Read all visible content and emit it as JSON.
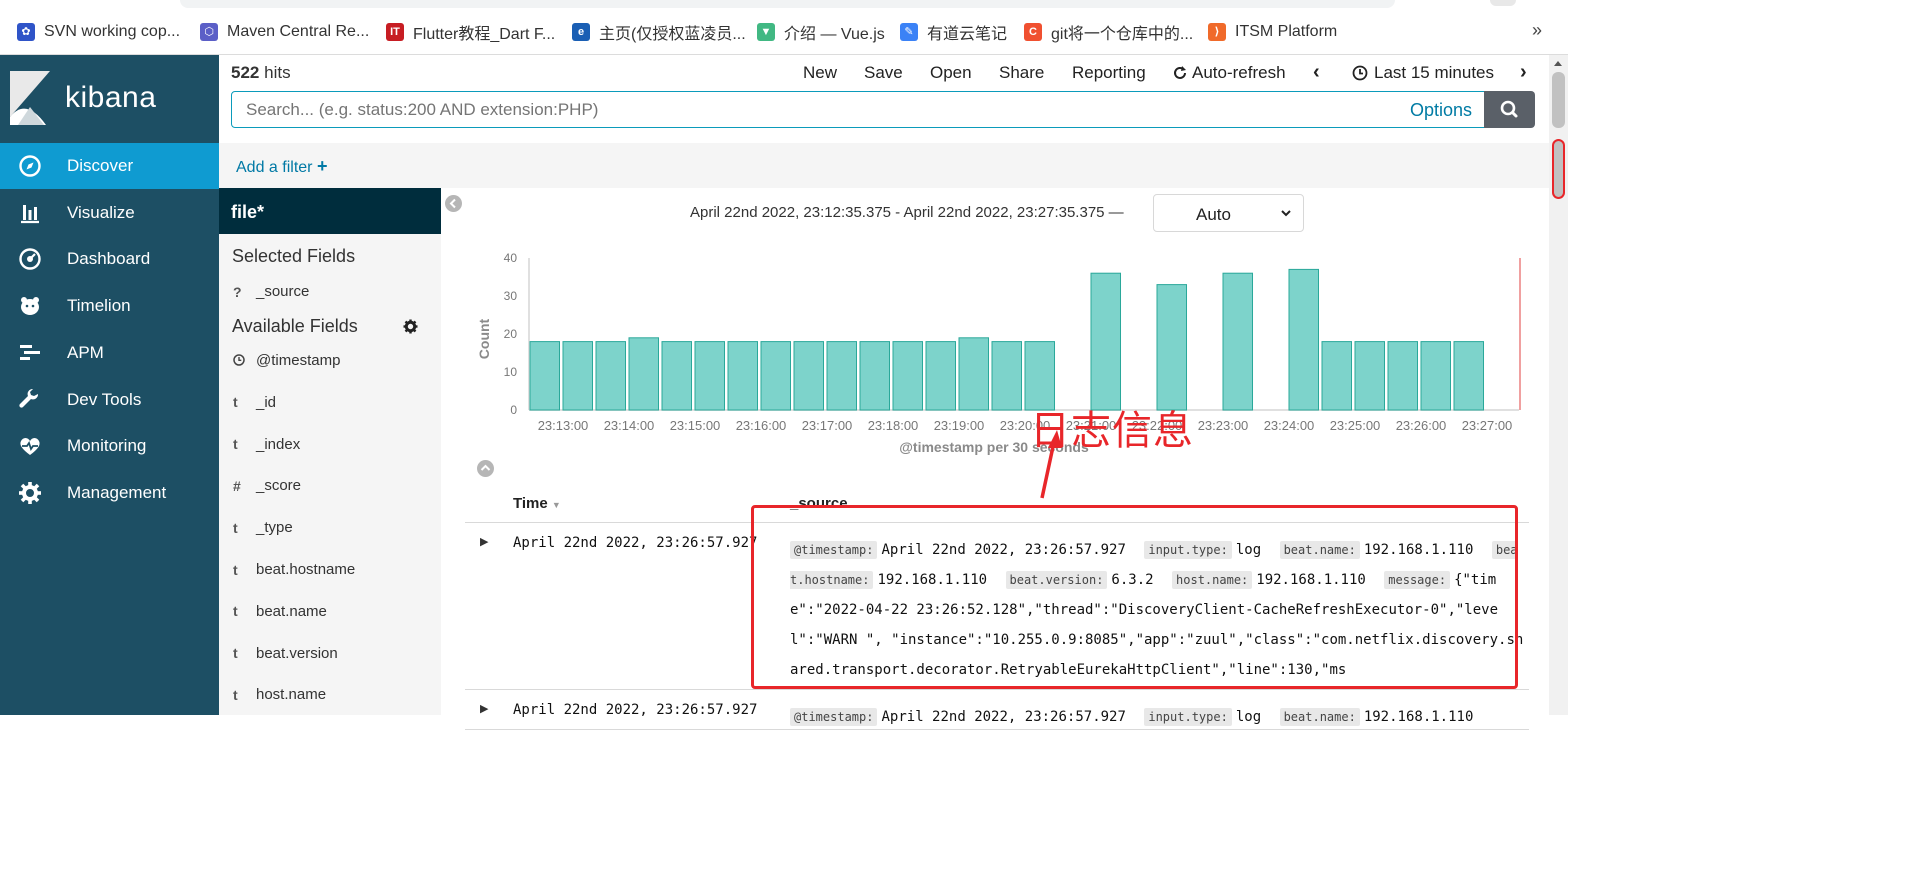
{
  "bookmarks": [
    {
      "label": "SVN working cop...",
      "icon": "paw-icon",
      "color": "#2f54c8"
    },
    {
      "label": "Maven Central Re...",
      "icon": "hexagon-icon",
      "color": "#5b5fc7"
    },
    {
      "label": "Flutter教程_Dart F...",
      "icon": "it-icon",
      "color": "#c71d23"
    },
    {
      "label": "主页(仅授权蓝凌员...",
      "icon": "ekp-icon",
      "color": "#1a5fb4"
    },
    {
      "label": "介绍 — Vue.js",
      "icon": "vue-icon",
      "color": "#41b883"
    },
    {
      "label": "有道云笔记",
      "icon": "note-icon",
      "color": "#3b82f6"
    },
    {
      "label": "git将一个仓库中的...",
      "icon": "c-icon",
      "color": "#f05030"
    },
    {
      "label": "ITSM Platform",
      "icon": "itsm-icon",
      "color": "#f06a2a"
    }
  ],
  "bookmarks_more": "»",
  "app": {
    "logo_text": "kibana"
  },
  "nav": [
    {
      "label": "Discover",
      "icon": "compass-icon",
      "active": true
    },
    {
      "label": "Visualize",
      "icon": "bar-chart-icon"
    },
    {
      "label": "Dashboard",
      "icon": "dashboard-icon"
    },
    {
      "label": "Timelion",
      "icon": "bear-icon"
    },
    {
      "label": "APM",
      "icon": "apm-icon"
    },
    {
      "label": "Dev Tools",
      "icon": "wrench-icon"
    },
    {
      "label": "Monitoring",
      "icon": "heartbeat-icon"
    },
    {
      "label": "Management",
      "icon": "gear-icon"
    }
  ],
  "topbar": {
    "hits_count": "522",
    "hits_label": "hits",
    "menu": [
      "New",
      "Save",
      "Open",
      "Share",
      "Reporting"
    ],
    "auto_refresh": "Auto-refresh",
    "time_label": "Last 15 minutes",
    "search_placeholder": "Search... (e.g. status:200 AND extension:PHP)",
    "options_label": "Options"
  },
  "filter": {
    "add_label": "Add a filter"
  },
  "fields": {
    "index_pattern": "file*",
    "selected_heading": "Selected Fields",
    "selected": [
      {
        "type": "?",
        "name": "_source"
      }
    ],
    "available_heading": "Available Fields",
    "available": [
      {
        "type": "clock",
        "name": "@timestamp"
      },
      {
        "type": "t",
        "name": "_id"
      },
      {
        "type": "t",
        "name": "_index"
      },
      {
        "type": "#",
        "name": "_score"
      },
      {
        "type": "t",
        "name": "_type"
      },
      {
        "type": "t",
        "name": "beat.hostname"
      },
      {
        "type": "t",
        "name": "beat.name"
      },
      {
        "type": "t",
        "name": "beat.version"
      },
      {
        "type": "t",
        "name": "host.name"
      }
    ]
  },
  "histogram": {
    "range_text": "April 22nd 2022, 23:12:35.375 - April 22nd 2022, 23:27:35.375 —",
    "interval": "Auto"
  },
  "chart_data": {
    "type": "bar",
    "title": "",
    "xlabel": "@timestamp per 30 seconds",
    "ylabel": "Count",
    "ylim": [
      0,
      40
    ],
    "yticks": [
      0,
      10,
      20,
      30,
      40
    ],
    "xticks": [
      "23:13:00",
      "23:14:00",
      "23:15:00",
      "23:16:00",
      "23:17:00",
      "23:18:00",
      "23:19:00",
      "23:20:00",
      "23:21:00",
      "23:22:00",
      "23:23:00",
      "23:24:00",
      "23:25:00",
      "23:26:00",
      "23:27:00"
    ],
    "values": [
      18,
      18,
      18,
      19,
      18,
      18,
      18,
      18,
      18,
      18,
      18,
      18,
      18,
      19,
      18,
      18,
      0,
      36,
      0,
      33,
      0,
      36,
      0,
      37,
      18,
      18,
      18,
      18,
      18,
      0
    ],
    "bar_color": "#7dd3cb",
    "bar_stroke": "#2aa89a"
  },
  "table": {
    "col_time": "Time",
    "col_source": "_source",
    "rows": [
      {
        "time": "April 22nd 2022, 23:26:57.927",
        "fields": [
          {
            "k": "@timestamp:",
            "v": "April 22nd 2022, 23:26:57.927"
          },
          {
            "k": "input.type:",
            "v": "log"
          },
          {
            "k": "beat.name:",
            "v": "192.168.1.110"
          },
          {
            "k": "beat.hostname:",
            "v": "192.168.1.110"
          },
          {
            "k": "beat.version:",
            "v": "6.3.2"
          },
          {
            "k": "host.name:",
            "v": "192.168.1.110"
          },
          {
            "k": "message:",
            "v": "{\"time\":\"2022-04-22 23:26:52.128\",\"thread\":\"DiscoveryClient-CacheRefreshExecutor-0\",\"level\":\"WARN \", \"instance\":\"10.255.0.9:8085\",\"app\":\"zuul\",\"class\":\"com.netflix.discovery.shared.transport.decorator.RetryableEurekaHttpClient\",\"line\":130,\"ms"
          }
        ]
      },
      {
        "time": "April 22nd 2022, 23:26:57.927",
        "fields": [
          {
            "k": "@timestamp:",
            "v": "April 22nd 2022, 23:26:57.927"
          },
          {
            "k": "input.type:",
            "v": "log"
          },
          {
            "k": "beat.name:",
            "v": "192.168.1.110"
          }
        ]
      }
    ]
  },
  "annotation": {
    "label": "日志信息",
    "color": "#e8262a"
  }
}
